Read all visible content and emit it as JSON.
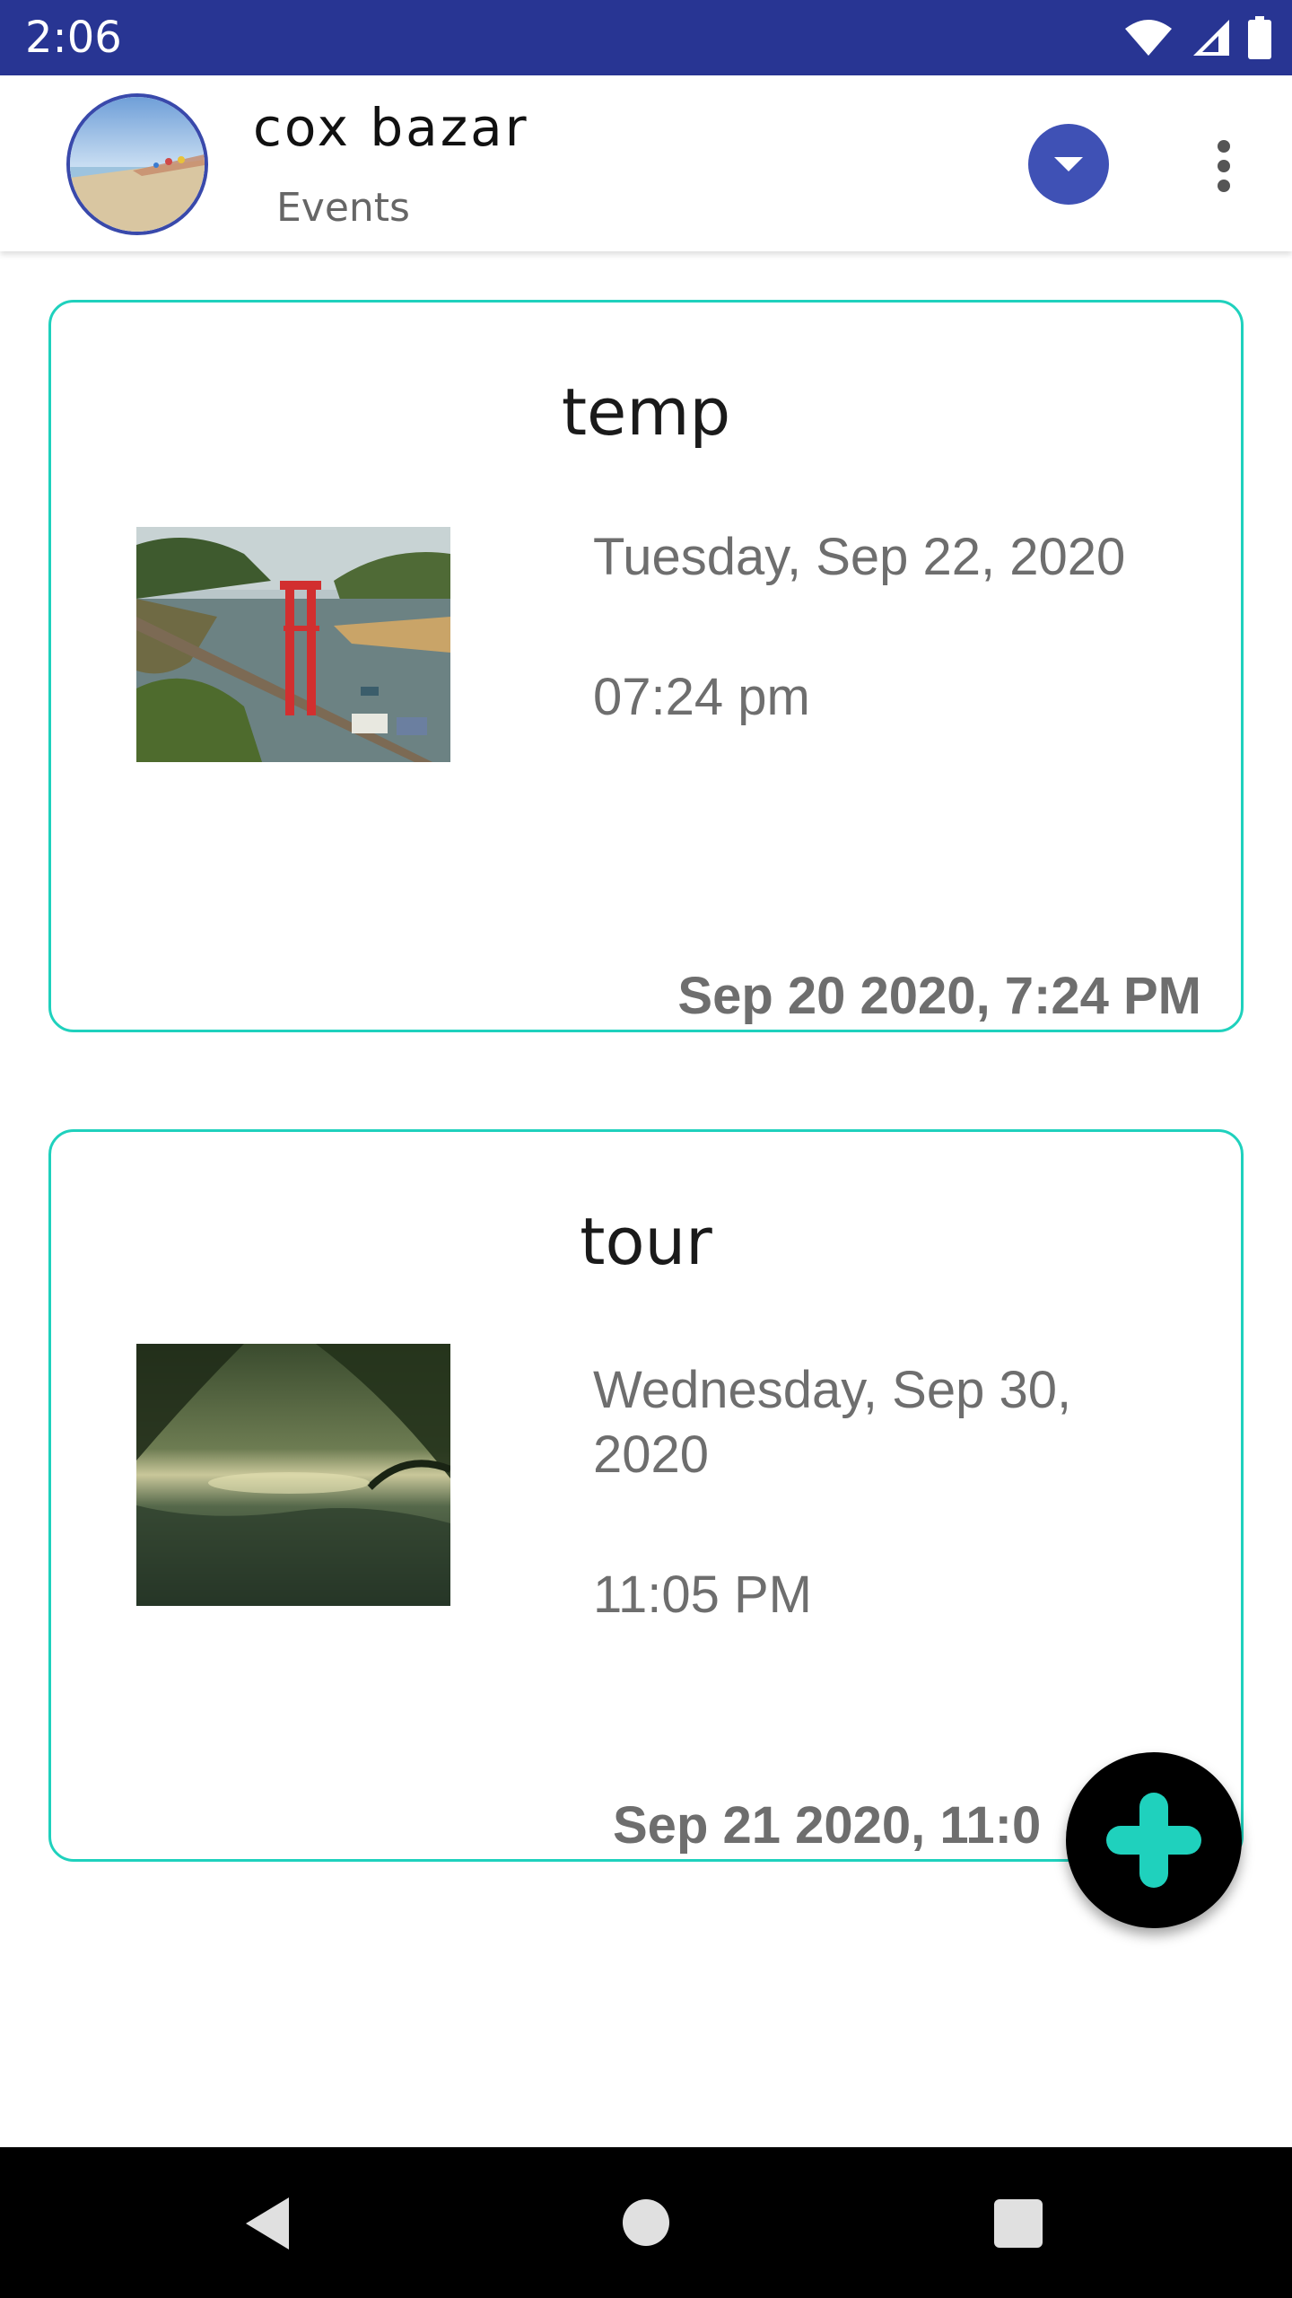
{
  "status_bar": {
    "time": "2:06",
    "background_color": "#283593",
    "icons": [
      "wifi-icon",
      "signal-icon",
      "battery-icon"
    ]
  },
  "app_bar": {
    "title": "cox bazar",
    "subtitle": "Events",
    "avatar_icon": "beach-avatar",
    "dropdown_icon": "chevron-down-icon",
    "dropdown_color": "#3f51b5",
    "overflow_icon": "more-vert-icon"
  },
  "events": [
    {
      "title": "temp",
      "image": "bridge-lake-photo",
      "date": "Tuesday, Sep 22, 2020",
      "time": "07:24 pm",
      "created": "Sep 20 2020, 7:24 PM"
    },
    {
      "title": "tour",
      "image": "forest-river-photo",
      "date": "Wednesday, Sep 30, 2020",
      "time": "11:05 PM",
      "created": "Sep 21 2020, 11:0"
    }
  ],
  "card_border_color": "#1fd1bd",
  "fab": {
    "icon": "plus-icon",
    "color": "#1fd1bd"
  },
  "nav_bar": {
    "icons": [
      "back-icon",
      "home-icon",
      "recents-icon"
    ]
  }
}
